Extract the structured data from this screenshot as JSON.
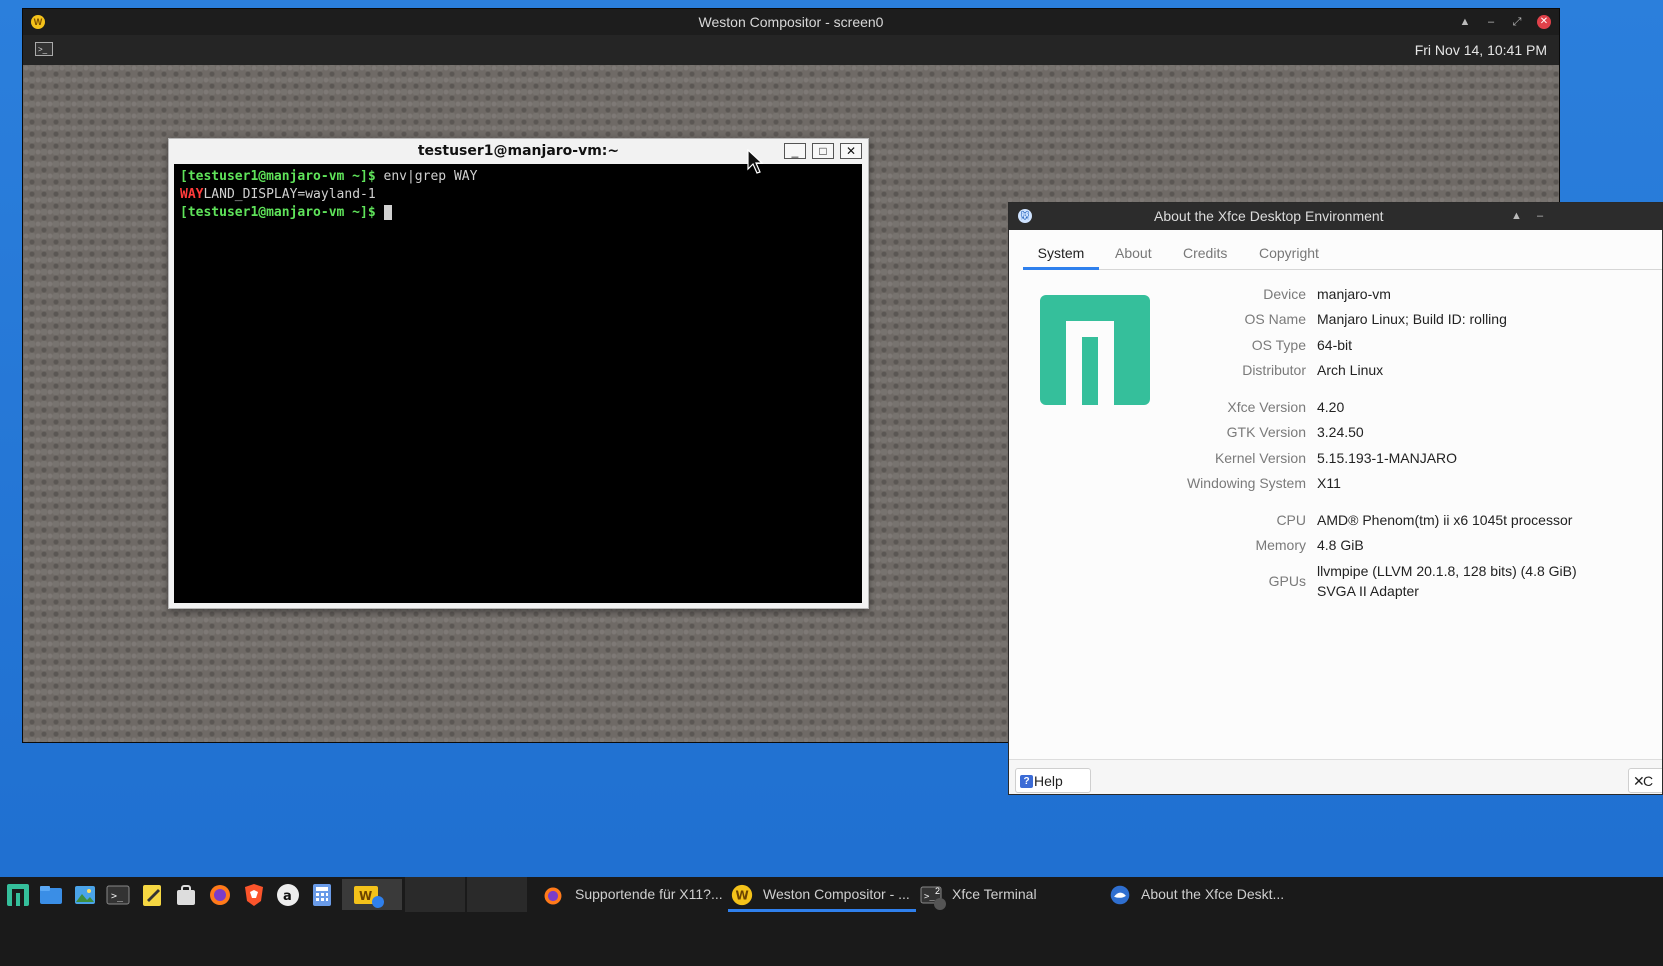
{
  "weston": {
    "title": "Weston Compositor - screen0",
    "clock": "Fri Nov 14, 10:41 PM",
    "logo_letter": "W"
  },
  "terminal": {
    "title": "testuser1@manjaro-vm:~",
    "prompt": "[testuser1@manjaro-vm ~]$",
    "command": " env|grep WAY",
    "output_highlight": "WAY",
    "output_rest": "LAND_DISPLAY=wayland-1"
  },
  "about": {
    "title": "About the Xfce Desktop Environment",
    "tabs": [
      "System",
      "About",
      "Credits",
      "Copyright"
    ],
    "rows": [
      {
        "key": "Device",
        "value": "manjaro-vm"
      },
      {
        "key": "OS Name",
        "value": "Manjaro Linux; Build ID: rolling"
      },
      {
        "key": "OS Type",
        "value": "64-bit"
      },
      {
        "key": "Distributor",
        "value": "Arch Linux"
      },
      {
        "key": "Xfce Version",
        "value": "4.20"
      },
      {
        "key": "GTK Version",
        "value": "3.24.50"
      },
      {
        "key": "Kernel Version",
        "value": "5.15.193-1-MANJARO"
      },
      {
        "key": "Windowing System",
        "value": "X11"
      },
      {
        "key": "CPU",
        "value": "AMD® Phenom(tm) ii x6 1045t processor"
      },
      {
        "key": "Memory",
        "value": "4.8 GiB"
      },
      {
        "key": "GPUs",
        "value": "llvmpipe (LLVM 20.1.8, 128 bits) (4.8 GiB)",
        "value2": "SVGA II Adapter"
      }
    ],
    "help_label": "Help",
    "close_label": "C"
  },
  "taskbar": {
    "launchers": [
      "manjaro-menu-icon",
      "files-icon",
      "image-viewer-icon",
      "terminal-icon",
      "text-editor-icon",
      "app-store-icon",
      "firefox-icon",
      "brave-icon",
      "amazon-icon",
      "calculator-icon",
      "weston-icon"
    ],
    "windows": [
      {
        "label": "Supportende für X11?...",
        "icon": "firefox-icon"
      },
      {
        "label": "Weston Compositor - ...",
        "icon": "weston-icon"
      },
      {
        "label": "Xfce Terminal",
        "icon": "terminal-icon",
        "badge": "2"
      },
      {
        "label": "About the Xfce Deskt...",
        "icon": "xfce-icon"
      }
    ]
  },
  "colors": {
    "accent": "#2f80ed",
    "manjaro_green": "#35bf9b",
    "prompt_green": "#5fe35a",
    "grep_red": "#ff3b3b"
  }
}
